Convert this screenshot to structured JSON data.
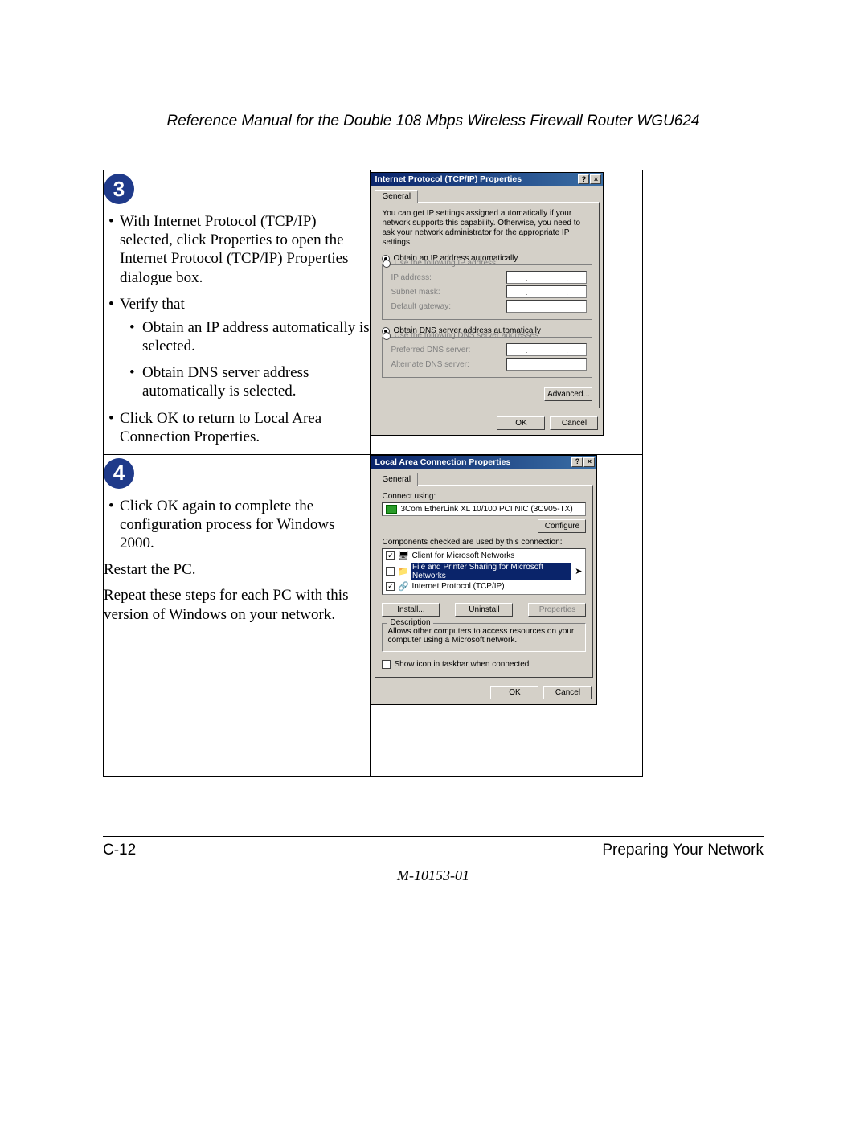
{
  "header": {
    "title": "Reference Manual for the Double 108 Mbps Wireless Firewall Router WGU624"
  },
  "step3": {
    "badge": "3",
    "b1": "With Internet Protocol (TCP/IP) selected, click Properties to open the Internet Protocol (TCP/IP) Properties dialogue box.",
    "b2": "Verify that",
    "b2a": "Obtain an IP address automatically is selected.",
    "b2b": "Obtain DNS server address automatically is selected.",
    "b3": "Click OK to return to Local Area Connection Properties."
  },
  "step4": {
    "badge": "4",
    "b1": "Click OK again to complete the configuration process for Windows 2000.",
    "p1": "Restart the PC.",
    "p2": "Repeat these steps for each PC with this version of Windows on your network."
  },
  "tcpip": {
    "title": "Internet Protocol (TCP/IP) Properties",
    "help": "?",
    "close": "×",
    "tab": "General",
    "desc": "You can get IP settings assigned automatically if your network supports this capability. Otherwise, you need to ask your network administrator for the appropriate IP settings.",
    "r1": "Obtain an IP address automatically",
    "r2": "Use the following IP address:",
    "f_ip": "IP address:",
    "f_mask": "Subnet mask:",
    "f_gw": "Default gateway:",
    "r3": "Obtain DNS server address automatically",
    "r4": "Use the following DNS server addresses:",
    "f_pdns": "Preferred DNS server:",
    "f_adns": "Alternate DNS server:",
    "adv": "Advanced...",
    "ok": "OK",
    "cancel": "Cancel"
  },
  "lac": {
    "title": "Local Area Connection Properties",
    "help": "?",
    "close": "×",
    "tab": "General",
    "connect_using": "Connect using:",
    "nic": "3Com EtherLink XL 10/100 PCI NIC (3C905-TX)",
    "configure": "Configure",
    "components_label": "Components checked are used by this connection:",
    "c1": "Client for Microsoft Networks",
    "c2": "File and Printer Sharing for Microsoft Networks",
    "c3": "Internet Protocol (TCP/IP)",
    "install": "Install...",
    "uninstall": "Uninstall",
    "properties": "Properties",
    "desc_label": "Description",
    "desc_text": "Allows other computers to access resources on your computer using a Microsoft network.",
    "show_icon": "Show icon in taskbar when connected",
    "ok": "OK",
    "cancel": "Cancel"
  },
  "footer": {
    "left": "C-12",
    "right": "Preparing Your Network",
    "docnum": "M-10153-01"
  }
}
